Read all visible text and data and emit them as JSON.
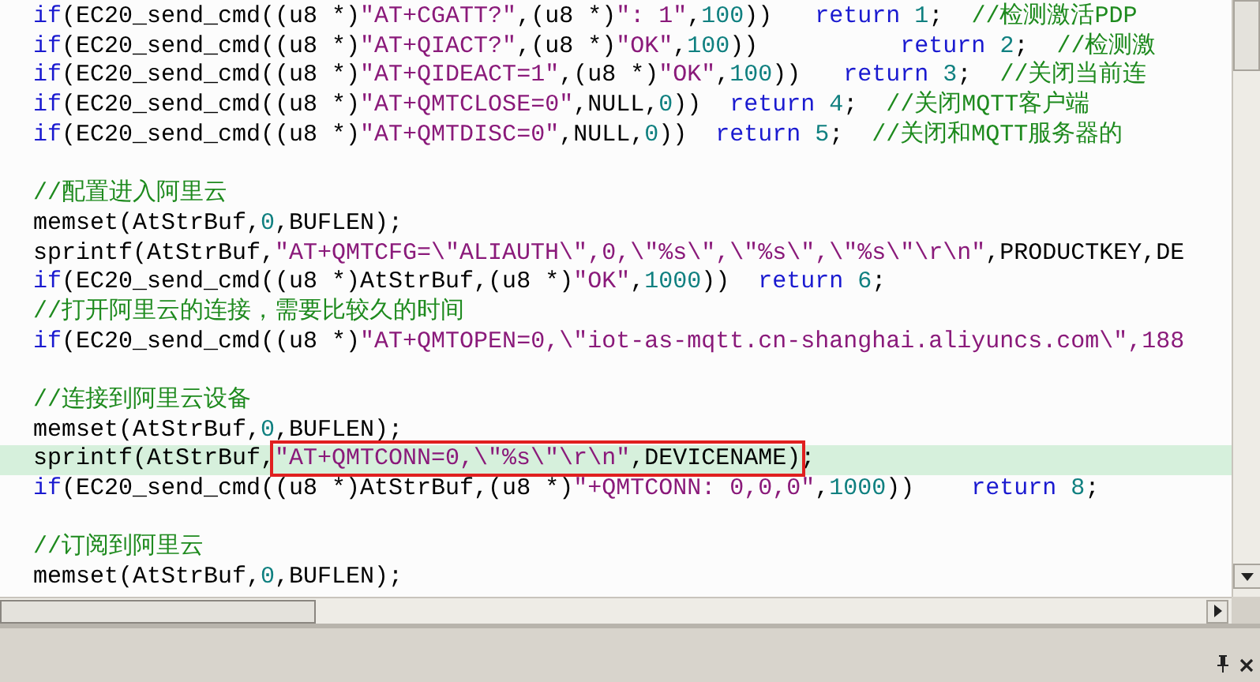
{
  "editor": {
    "blocks": [
      {
        "lines": [
          {
            "highlighted": false,
            "tokens": [
              {
                "kind": "kw",
                "text": "if"
              },
              {
                "kind": "plain",
                "text": "(EC20_send_cmd((u8 *)"
              },
              {
                "kind": "str",
                "text": "\"AT+CGATT?\""
              },
              {
                "kind": "plain",
                "text": ",(u8 *)"
              },
              {
                "kind": "str",
                "text": "\": 1\""
              },
              {
                "kind": "plain",
                "text": ","
              },
              {
                "kind": "num",
                "text": "100"
              },
              {
                "kind": "plain",
                "text": "))   "
              },
              {
                "kind": "kw",
                "text": "return "
              },
              {
                "kind": "num",
                "text": "1"
              },
              {
                "kind": "plain",
                "text": ";  "
              },
              {
                "kind": "cmt",
                "text": "//检测激活PDP"
              }
            ]
          },
          {
            "highlighted": false,
            "tokens": [
              {
                "kind": "kw",
                "text": "if"
              },
              {
                "kind": "plain",
                "text": "(EC20_send_cmd((u8 *)"
              },
              {
                "kind": "str",
                "text": "\"AT+QIACT?\""
              },
              {
                "kind": "plain",
                "text": ",(u8 *)"
              },
              {
                "kind": "str",
                "text": "\"OK\""
              },
              {
                "kind": "plain",
                "text": ","
              },
              {
                "kind": "num",
                "text": "100"
              },
              {
                "kind": "plain",
                "text": "))          "
              },
              {
                "kind": "kw",
                "text": "return "
              },
              {
                "kind": "num",
                "text": "2"
              },
              {
                "kind": "plain",
                "text": ";  "
              },
              {
                "kind": "cmt",
                "text": "//检测激"
              }
            ]
          },
          {
            "highlighted": false,
            "tokens": [
              {
                "kind": "kw",
                "text": "if"
              },
              {
                "kind": "plain",
                "text": "(EC20_send_cmd((u8 *)"
              },
              {
                "kind": "str",
                "text": "\"AT+QIDEACT=1\""
              },
              {
                "kind": "plain",
                "text": ",(u8 *)"
              },
              {
                "kind": "str",
                "text": "\"OK\""
              },
              {
                "kind": "plain",
                "text": ","
              },
              {
                "kind": "num",
                "text": "100"
              },
              {
                "kind": "plain",
                "text": "))   "
              },
              {
                "kind": "kw",
                "text": "return "
              },
              {
                "kind": "num",
                "text": "3"
              },
              {
                "kind": "plain",
                "text": ";  "
              },
              {
                "kind": "cmt",
                "text": "//关闭当前连"
              }
            ]
          },
          {
            "highlighted": false,
            "tokens": [
              {
                "kind": "kw",
                "text": "if"
              },
              {
                "kind": "plain",
                "text": "(EC20_send_cmd((u8 *)"
              },
              {
                "kind": "str",
                "text": "\"AT+QMTCLOSE=0\""
              },
              {
                "kind": "plain",
                "text": ",NULL,"
              },
              {
                "kind": "num",
                "text": "0"
              },
              {
                "kind": "plain",
                "text": "))  "
              },
              {
                "kind": "kw",
                "text": "return "
              },
              {
                "kind": "num",
                "text": "4"
              },
              {
                "kind": "plain",
                "text": ";  "
              },
              {
                "kind": "cmt",
                "text": "//关闭MQTT客户端"
              }
            ]
          },
          {
            "highlighted": false,
            "tokens": [
              {
                "kind": "kw",
                "text": "if"
              },
              {
                "kind": "plain",
                "text": "(EC20_send_cmd((u8 *)"
              },
              {
                "kind": "str",
                "text": "\"AT+QMTDISC=0\""
              },
              {
                "kind": "plain",
                "text": ",NULL,"
              },
              {
                "kind": "num",
                "text": "0"
              },
              {
                "kind": "plain",
                "text": "))  "
              },
              {
                "kind": "kw",
                "text": "return "
              },
              {
                "kind": "num",
                "text": "5"
              },
              {
                "kind": "plain",
                "text": ";  "
              },
              {
                "kind": "cmt",
                "text": "//关闭和MQTT服务器的"
              }
            ]
          }
        ]
      },
      {
        "lines": [
          {
            "highlighted": false,
            "tokens": [
              {
                "kind": "cmt",
                "text": "//配置进入阿里云"
              }
            ]
          },
          {
            "highlighted": false,
            "tokens": [
              {
                "kind": "plain",
                "text": "memset(AtStrBuf,"
              },
              {
                "kind": "num",
                "text": "0"
              },
              {
                "kind": "plain",
                "text": ",BUFLEN);"
              }
            ]
          },
          {
            "highlighted": false,
            "tokens": [
              {
                "kind": "plain",
                "text": "sprintf(AtStrBuf,"
              },
              {
                "kind": "str",
                "text": "\"AT+QMTCFG=\\\"ALIAUTH\\\",0,\\\"%s\\\",\\\"%s\\\",\\\"%s\\\"\\r\\n\""
              },
              {
                "kind": "plain",
                "text": ",PRODUCTKEY,DE"
              }
            ]
          },
          {
            "highlighted": false,
            "tokens": [
              {
                "kind": "kw",
                "text": "if"
              },
              {
                "kind": "plain",
                "text": "(EC20_send_cmd((u8 *)AtStrBuf,(u8 *)"
              },
              {
                "kind": "str",
                "text": "\"OK\""
              },
              {
                "kind": "plain",
                "text": ","
              },
              {
                "kind": "num",
                "text": "1000"
              },
              {
                "kind": "plain",
                "text": "))  "
              },
              {
                "kind": "kw",
                "text": "return "
              },
              {
                "kind": "num",
                "text": "6"
              },
              {
                "kind": "plain",
                "text": ";"
              }
            ]
          },
          {
            "highlighted": false,
            "tokens": [
              {
                "kind": "cmt",
                "text": "//打开阿里云的连接，需要比较久的时间"
              }
            ]
          },
          {
            "highlighted": false,
            "tokens": [
              {
                "kind": "kw",
                "text": "if"
              },
              {
                "kind": "plain",
                "text": "(EC20_send_cmd((u8 *)"
              },
              {
                "kind": "str",
                "text": "\"AT+QMTOPEN=0,\\\"iot-as-mqtt.cn-shanghai.aliyuncs.com\\\",188"
              }
            ]
          }
        ]
      },
      {
        "lines": [
          {
            "highlighted": false,
            "tokens": [
              {
                "kind": "cmt",
                "text": "//连接到阿里云设备"
              }
            ]
          },
          {
            "highlighted": false,
            "tokens": [
              {
                "kind": "plain",
                "text": "memset(AtStrBuf,"
              },
              {
                "kind": "num",
                "text": "0"
              },
              {
                "kind": "plain",
                "text": ",BUFLEN);"
              }
            ]
          },
          {
            "highlighted": true,
            "tokens": [
              {
                "kind": "plain",
                "text": "sprintf(AtStrBuf,"
              }
            ],
            "boxed_tokens": [
              {
                "kind": "str",
                "text": "\"AT+QMTCONN=0,\\\"%s\\\"\\r\\n\""
              },
              {
                "kind": "plain",
                "text": ",DEVICENAME)"
              }
            ],
            "after_tokens": [
              {
                "kind": "plain",
                "text": ";"
              }
            ]
          },
          {
            "highlighted": false,
            "tokens": [
              {
                "kind": "kw",
                "text": "if"
              },
              {
                "kind": "plain",
                "text": "(EC20_send_cmd((u8 *)AtStrBuf,(u8 *)"
              },
              {
                "kind": "str",
                "text": "\"+QMTCONN: 0,0,0\""
              },
              {
                "kind": "plain",
                "text": ","
              },
              {
                "kind": "num",
                "text": "1000"
              },
              {
                "kind": "plain",
                "text": "))    "
              },
              {
                "kind": "kw",
                "text": "return "
              },
              {
                "kind": "num",
                "text": "8"
              },
              {
                "kind": "plain",
                "text": ";"
              }
            ]
          }
        ]
      },
      {
        "lines": [
          {
            "highlighted": false,
            "tokens": [
              {
                "kind": "cmt",
                "text": "//订阅到阿里云"
              }
            ]
          },
          {
            "highlighted": false,
            "tokens": [
              {
                "kind": "plain",
                "text": "memset(AtStrBuf,"
              },
              {
                "kind": "num",
                "text": "0"
              },
              {
                "kind": "plain",
                "text": ",BUFLEN);"
              }
            ]
          }
        ]
      }
    ]
  }
}
